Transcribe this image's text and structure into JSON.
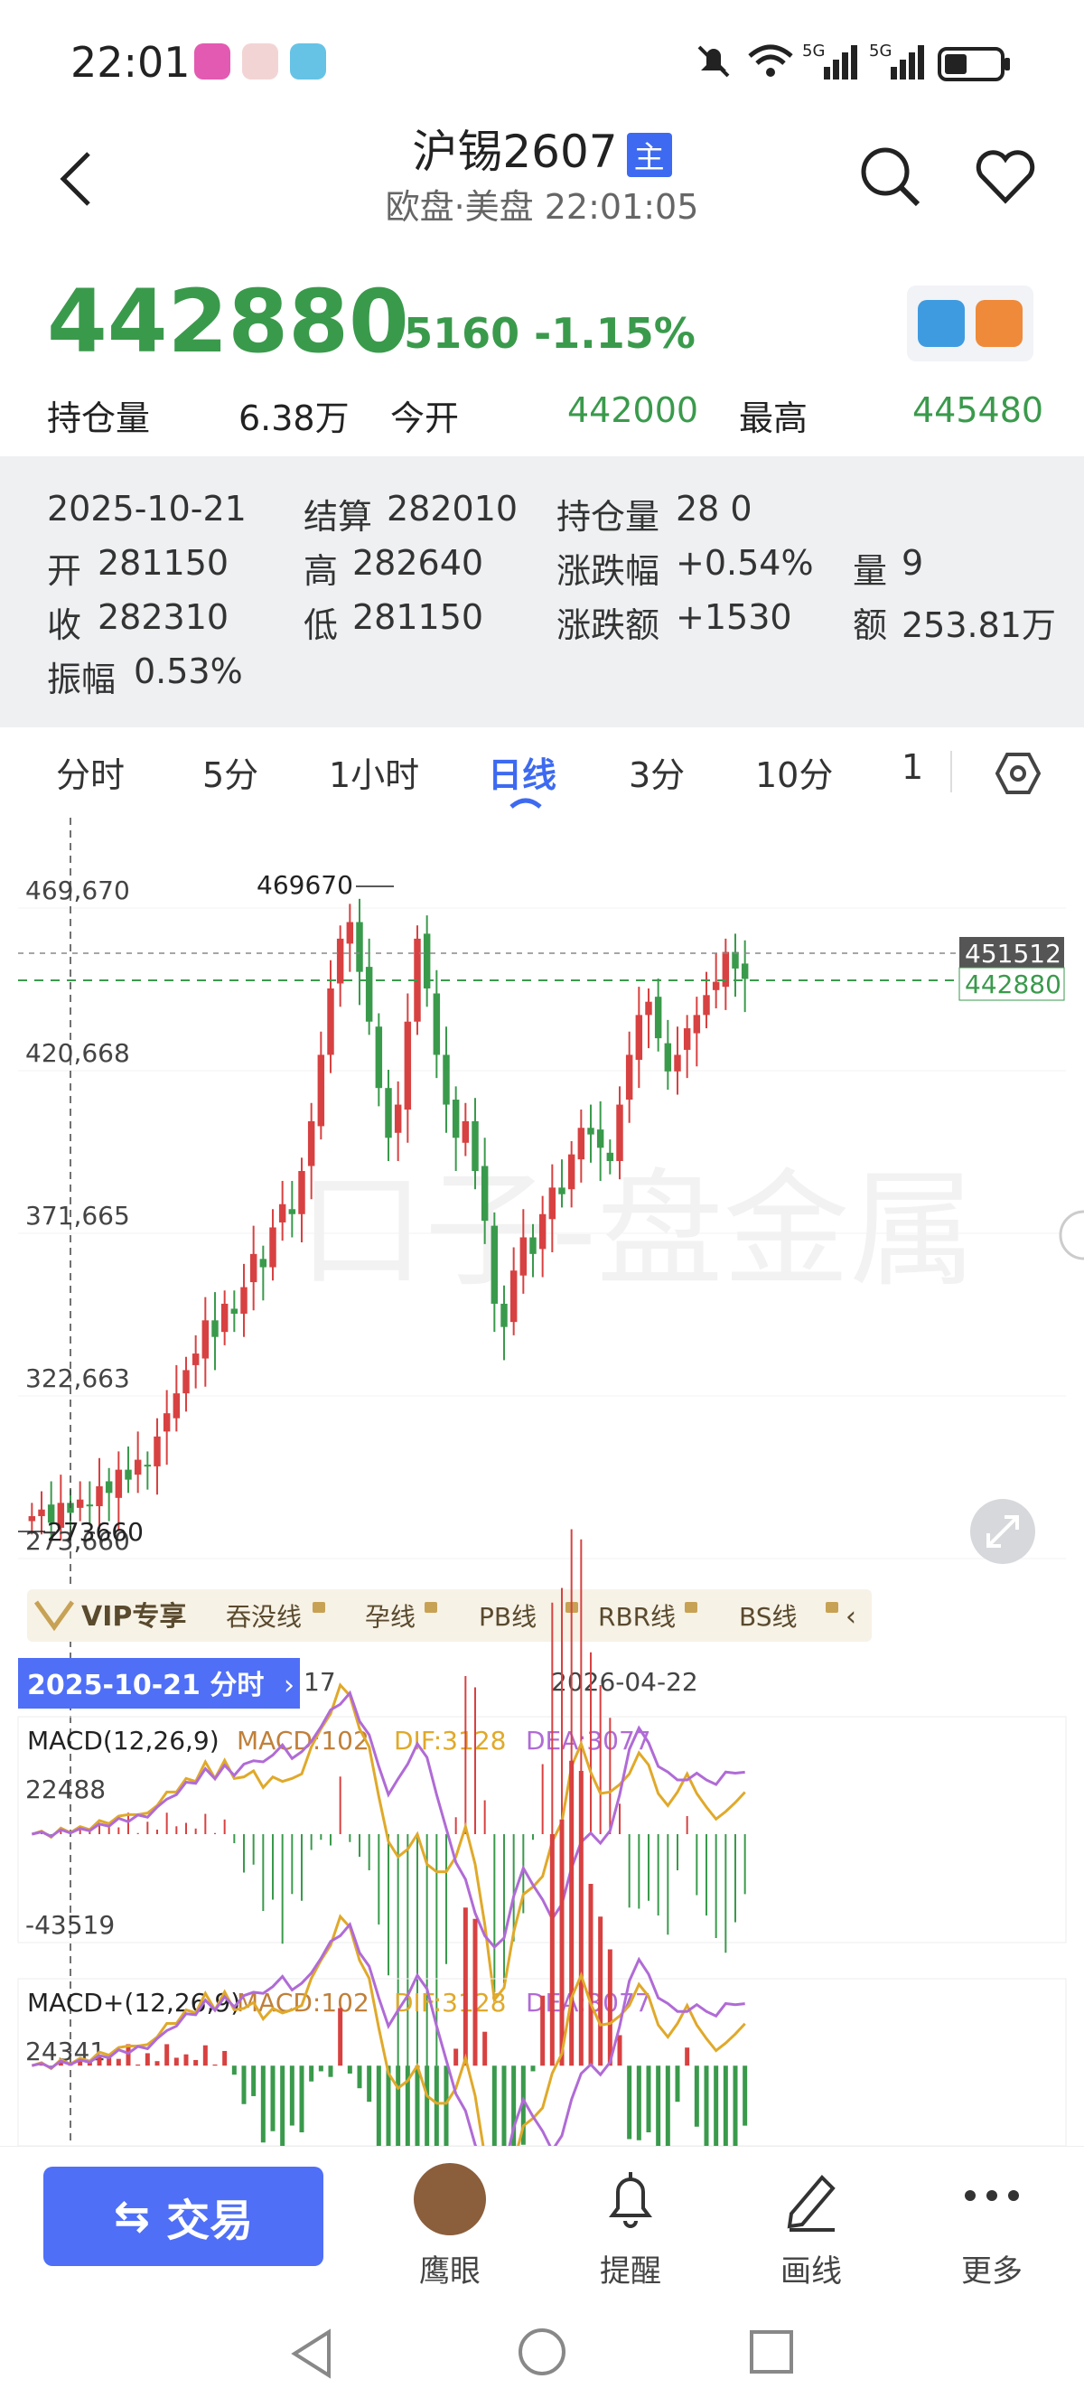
{
  "status_bar": {
    "time": "22:01",
    "icons": [
      "video-app-icon",
      "music-app-icon",
      "book-app-icon",
      "mute-icon",
      "wifi-icon",
      "signal-5g-icon",
      "signal-5g-icon",
      "battery-icon"
    ],
    "signal_labels": [
      "5G",
      "5G"
    ]
  },
  "header": {
    "title": "沪锡2607",
    "tag": "主",
    "subtitle": "欧盘·美盘  22:01:05"
  },
  "quote": {
    "price": "442880",
    "change": "-5160",
    "change_pct": "-1.15%",
    "stats": [
      {
        "label": "持仓量",
        "value": "6.38万"
      },
      {
        "label": "今开",
        "value": "442000"
      },
      {
        "label": "最高",
        "value": "445480"
      }
    ]
  },
  "popup": {
    "date": "2025-10-21",
    "settle_label": "结算",
    "settle": "282010",
    "oi_label": "持仓量",
    "oi": "28 0",
    "open_label": "开",
    "open": "281150",
    "high_label": "高",
    "high": "282640",
    "chgpct_label": "涨跌幅",
    "chgpct": "+0.54%",
    "vol_label": "量",
    "vol": "9",
    "close_label": "收",
    "close": "282310",
    "low_label": "低",
    "low": "281150",
    "chgamt_label": "涨跌额",
    "chgamt": "+1530",
    "amount_label": "额",
    "amount": "253.81万",
    "amp_label": "振幅",
    "amp": "0.53%"
  },
  "tabs": [
    {
      "label": "分时"
    },
    {
      "label": "5分"
    },
    {
      "label": "1小时"
    },
    {
      "label": "日线",
      "active": true
    },
    {
      "label": "3分"
    },
    {
      "label": "10分"
    },
    {
      "label": "1"
    }
  ],
  "chart_data": {
    "type": "candlestick",
    "y_ticks": [
      "469,670",
      "420,668",
      "371,665",
      "322,663",
      "273,660"
    ],
    "ylim": [
      273660,
      469670
    ],
    "max_label": "469670",
    "min_label": "273660",
    "right_labels": [
      "451512",
      "442880"
    ],
    "date_labels": [
      "17",
      "2026-04-22"
    ],
    "closes": [
      281000,
      283000,
      279000,
      285000,
      282000,
      286000,
      284000,
      290000,
      288000,
      295000,
      292000,
      298000,
      296000,
      305000,
      312000,
      318000,
      325000,
      330000,
      340000,
      335000,
      345000,
      342000,
      350000,
      360000,
      356000,
      368000,
      375000,
      372000,
      385000,
      400000,
      420000,
      440000,
      455000,
      460000,
      445000,
      430000,
      410000,
      395000,
      405000,
      430000,
      455000,
      440000,
      420000,
      405000,
      395000,
      400000,
      385000,
      370000,
      345000,
      338000,
      355000,
      365000,
      360000,
      372000,
      380000,
      378000,
      390000,
      398000,
      396000,
      392000,
      388000,
      405000,
      420000,
      432000,
      436000,
      425000,
      415000,
      420000,
      428000,
      432000,
      438000,
      442000,
      451000,
      446000,
      442880
    ],
    "watermark": "口子-盘金属",
    "indicators": [
      {
        "name": "MACD(12,26,9)",
        "macd": "MACD:102",
        "dif": "DIF:3128",
        "dea": "DEA:3077",
        "top": "22488",
        "bottom": "-43519"
      },
      {
        "name": "MACD+(12,26,9)",
        "macd": "MACD:102",
        "dif": "DIF:3128",
        "dea": "DEA:3077",
        "top": "24341"
      }
    ]
  },
  "toolbar": {
    "vip": "VIP专享",
    "items": [
      "吞没线",
      "孕线",
      "PB线",
      "RBR线",
      "BS线"
    ],
    "date_badge": "2025-10-21  分时"
  },
  "bottom_nav": {
    "trade": "交易",
    "items": [
      "鹰眼",
      "提醒",
      "画线",
      "更多"
    ]
  },
  "colors": {
    "up": "#d84141",
    "down": "#3a9a4c",
    "accent": "#4f6ff7",
    "dif": "#e0a92a",
    "dea": "#b06bd6"
  }
}
